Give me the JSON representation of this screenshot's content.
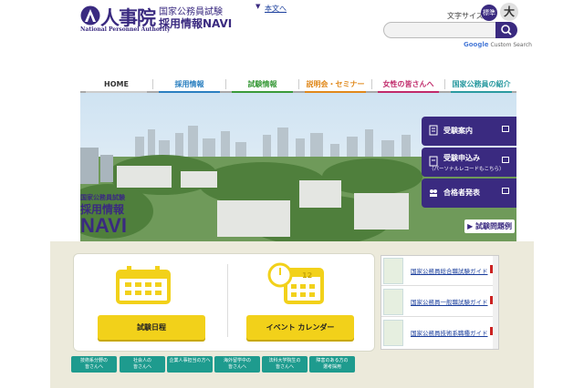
{
  "header": {
    "logo_main": "人事院",
    "logo_sub": "National Personnel Authority",
    "site_line1": "国家公務員試験",
    "site_line2": "採用情報NAVI",
    "skip_link": "本文へ",
    "font_size_label": "文字サイズ",
    "font_std": "標準",
    "font_big": "大",
    "search_placeholder": "",
    "cse_label": "Custom Search",
    "cse_google": "Google"
  },
  "nav": {
    "items": [
      {
        "label": "HOME",
        "color": "#333333",
        "line": "#cccccc"
      },
      {
        "label": "採用情報",
        "color": "#2a7fc0",
        "line": "#2a7fc0"
      },
      {
        "label": "試験情報",
        "color": "#3a9a3a",
        "line": "#3a9a3a"
      },
      {
        "label": "説明会・セミナー",
        "color": "#e0881a",
        "line": "#e0881a"
      },
      {
        "label": "女性の皆さんへ",
        "color": "#c02a6a",
        "line": "#c02a6a"
      },
      {
        "label": "国家公務員の紹介",
        "color": "#2a9aa0",
        "line": "#2a9aa0"
      }
    ]
  },
  "hero": {
    "title_small": "国家公務員試験",
    "title_mid": "採用情報",
    "title_big": "NAVI",
    "side_buttons": [
      {
        "label": "受験案内",
        "sub": ""
      },
      {
        "label": "受験申込み",
        "sub": "（パーソナルレコードもこちら）"
      },
      {
        "label": "合格者発表",
        "sub": ""
      }
    ],
    "past_exams": "試験問題例"
  },
  "cards": {
    "schedule_label": "試験日程",
    "event_label": "イベント カレンダー",
    "calendar_day": "12"
  },
  "guides": [
    {
      "label": "国家公務員総合職試験ガイド"
    },
    {
      "label": "国家公務員一般職試験ガイド"
    },
    {
      "label": "国家公務員技術系職種ガイド"
    }
  ],
  "bottom_buttons": [
    {
      "label": "技術系分野の\n皆さんへ"
    },
    {
      "label": "社会人の\n皆さんへ"
    },
    {
      "label": "企業人事担当の方へ"
    },
    {
      "label": "海外留学中の\n皆さんへ"
    },
    {
      "label": "法科大学院生の\n皆さんへ"
    },
    {
      "label": "障害のある方の\n選考採用"
    }
  ],
  "colors": {
    "brand": "#3a2a80",
    "accent_yellow": "#f2d11a",
    "teal": "#1e9b8e"
  }
}
